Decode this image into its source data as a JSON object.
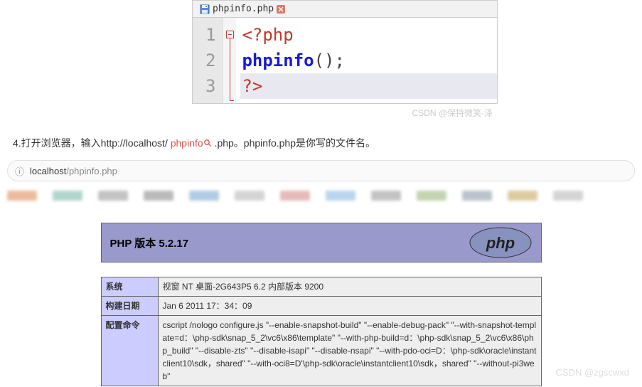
{
  "editor": {
    "tab_label": "phpinfo.php",
    "line_numbers": [
      "1",
      "2",
      "3"
    ],
    "line1_tag": "<?php",
    "line2_func": "phpinfo",
    "line2_paren": "();",
    "line3_tag": "?>"
  },
  "watermark1": "CSDN @保持微笑-泽",
  "instruction": {
    "prefix": "4.打开浏览器，输入http://localhost/ ",
    "red": "phpinfo",
    "suffix": " .php。phpinfo.php是你写的文件名。"
  },
  "addressbar": {
    "host": "localhost",
    "path": "/phpinfo.php"
  },
  "phpinfo": {
    "title": "PHP 版本 5.2.17",
    "rows": [
      {
        "label": "系统",
        "value": "视窗 NT 桌面-2G643P5 6.2 内部版本 9200"
      },
      {
        "label": "构建日期",
        "value": "Jan 6 2011 17：34：09"
      },
      {
        "label": "配置命令",
        "value": "cscript /nologo configure.js \"--enable-snapshot-build\" \"--enable-debug-pack\" \"--with-snapshot-template=d：\\php-sdk\\snap_5_2\\vc6\\x86\\template\" \"--with-php-build=d：\\php-sdk\\snap_5_2\\vc6\\x86\\php_build\" \"--disable-zts\" \"--disable-isapi\" \"--disable-nsapi\" \"--with-pdo-oci=D：\\php-sdk\\oracle\\instantclient10\\sdk，shared\" \"--with-oci8=D'\\php-sdk\\oracle\\instantclient10\\sdk，shared\" \"--without-pi3web\""
      }
    ]
  },
  "watermark2": "CSDN @zgscwxd"
}
